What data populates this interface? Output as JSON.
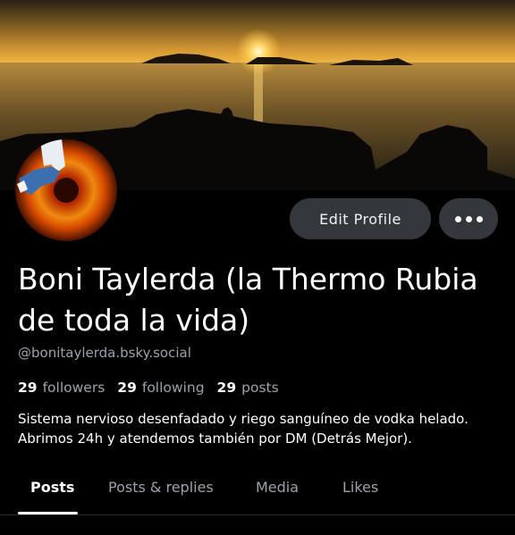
{
  "profile": {
    "display_name": "Boni Taylerda (la Thermo Rubia de toda la vida)",
    "handle": "@bonitaylerda.bsky.social",
    "bio": "Sistema nervioso desenfadado y riego sanguíneo de vodka helado. Abrimos 24h y atendemos también por DM (Detrás Mejor)."
  },
  "stats": {
    "followers_count": "29",
    "followers_label": "followers",
    "following_count": "29",
    "following_label": "following",
    "posts_count": "29",
    "posts_label": "posts"
  },
  "actions": {
    "edit_profile_label": "Edit Profile",
    "more_icon": "ellipsis-icon"
  },
  "tabs": [
    {
      "label": "Posts",
      "active": true
    },
    {
      "label": "Posts & replies",
      "active": false
    },
    {
      "label": "Media",
      "active": false
    },
    {
      "label": "Likes",
      "active": false
    }
  ],
  "colors": {
    "background": "#000000",
    "button_bg": "#34383d",
    "muted_text": "#9aa3ad"
  }
}
